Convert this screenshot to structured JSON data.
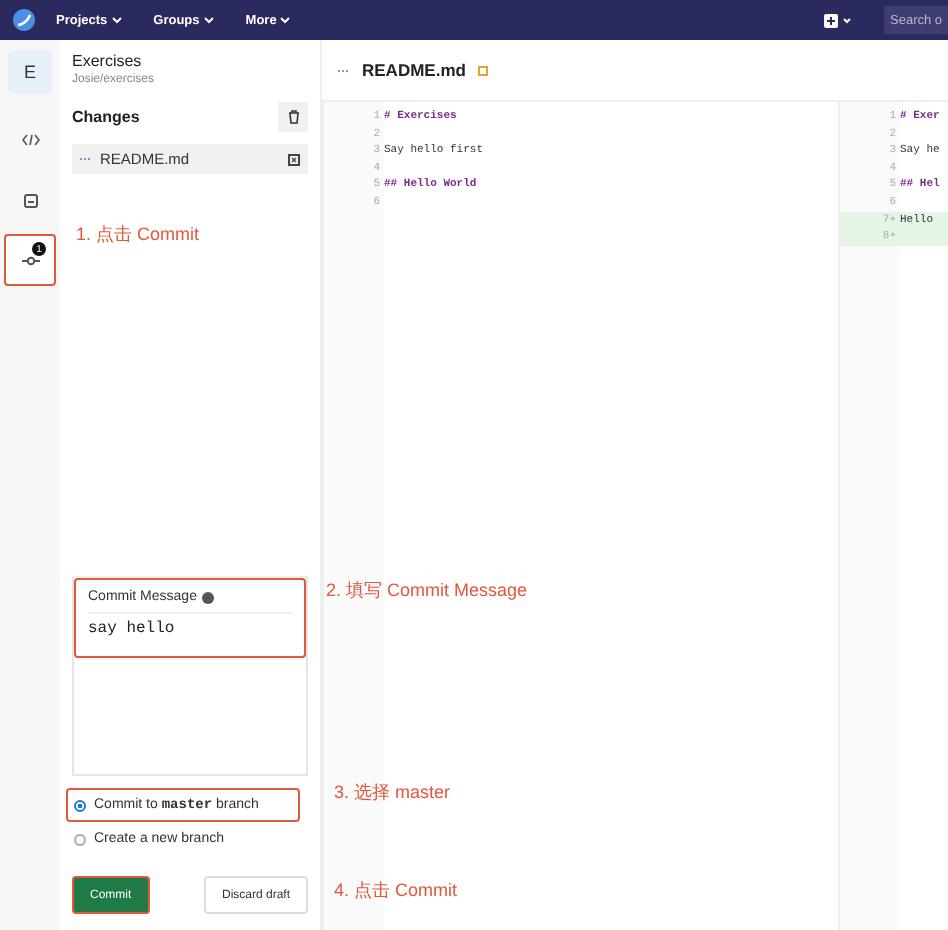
{
  "navbar": {
    "menus": [
      {
        "label": "Projects"
      },
      {
        "label": "Groups"
      },
      {
        "label": "More"
      }
    ],
    "search": {
      "placeholder": "Search o"
    }
  },
  "project": {
    "initial": "E",
    "name": "Exercises",
    "path": "Josie/exercises"
  },
  "rail": [
    {
      "kind": "code",
      "selected": false
    },
    {
      "kind": "review",
      "selected": false
    },
    {
      "kind": "commit",
      "selected": true,
      "badge": "1"
    }
  ],
  "changes": {
    "title": "Changes",
    "files": [
      {
        "name": "README.md"
      }
    ]
  },
  "commit": {
    "label": "Commit Message",
    "value": "say hello",
    "options": [
      {
        "parts": [
          "Commit to ",
          "master",
          " branch"
        ],
        "selected": true
      },
      {
        "parts": [
          "Create a new branch"
        ],
        "selected": false
      }
    ],
    "buttons": [
      {
        "label": "Commit",
        "kind": "primary"
      },
      {
        "label": "Discard draft",
        "kind": "secondary"
      }
    ]
  },
  "editor": {
    "file": "README.md",
    "modified": true,
    "left": [
      {
        "n": "1",
        "text": "# Exercises",
        "kind": "heading"
      },
      {
        "n": "2"
      },
      {
        "n": "3",
        "text": "Say hello first",
        "kind": "plain"
      },
      {
        "n": "4"
      },
      {
        "n": "5",
        "text": "## Hello World",
        "kind": "heading"
      },
      {
        "n": "6"
      }
    ],
    "right": [
      {
        "n": "1",
        "text": "# Exer",
        "kind": "heading",
        "added": false
      },
      {
        "n": "2",
        "added": false
      },
      {
        "n": "3",
        "text": "Say he",
        "kind": "plain",
        "added": false
      },
      {
        "n": "4",
        "added": false
      },
      {
        "n": "5",
        "text": "## Hel",
        "kind": "heading",
        "added": false
      },
      {
        "n": "6",
        "added": false
      },
      {
        "n": "7+",
        "text": "Hello",
        "kind": "plain",
        "added": true
      },
      {
        "n": "8+",
        "added": true
      }
    ]
  },
  "annotations": [
    "1. 点击 Commit",
    "2. 填写 Commit Message",
    "3. 选择 master",
    "4. 点击 Commit"
  ]
}
